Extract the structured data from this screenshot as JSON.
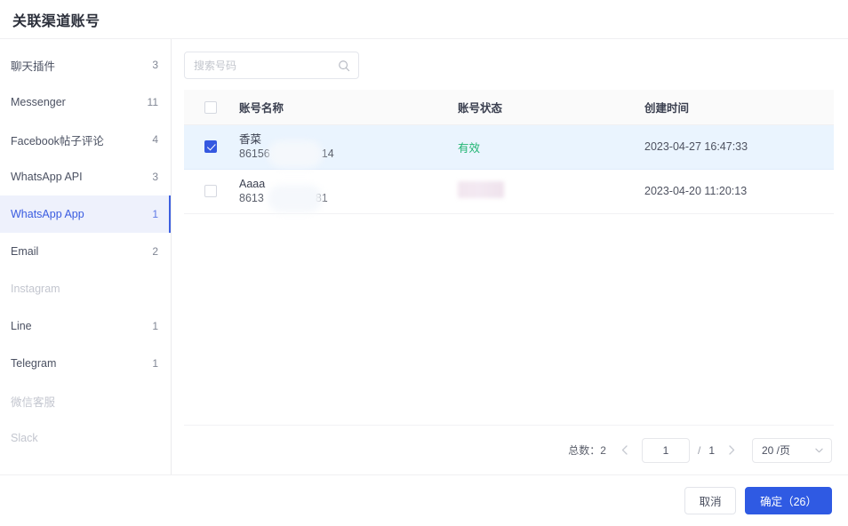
{
  "header": {
    "title": "关联渠道账号"
  },
  "sidebar": {
    "items": [
      {
        "label": "聊天插件",
        "count": "3",
        "state": "normal"
      },
      {
        "label": "Messenger",
        "count": "11",
        "state": "normal"
      },
      {
        "label": "Facebook帖子评论",
        "count": "4",
        "state": "normal"
      },
      {
        "label": "WhatsApp API",
        "count": "3",
        "state": "normal"
      },
      {
        "label": "WhatsApp App",
        "count": "1",
        "state": "active"
      },
      {
        "label": "Email",
        "count": "2",
        "state": "normal"
      },
      {
        "label": "Instagram",
        "count": "",
        "state": "disabled"
      },
      {
        "label": "Line",
        "count": "1",
        "state": "normal"
      },
      {
        "label": "Telegram",
        "count": "1",
        "state": "normal"
      },
      {
        "label": "微信客服",
        "count": "",
        "state": "disabled"
      },
      {
        "label": "Slack",
        "count": "",
        "state": "disabled"
      }
    ]
  },
  "search": {
    "placeholder": "搜索号码",
    "value": "",
    "icon": "search-icon"
  },
  "table": {
    "columns": [
      {
        "key": "checkbox",
        "label": ""
      },
      {
        "key": "name",
        "label": "账号名称"
      },
      {
        "key": "status",
        "label": "账号状态"
      },
      {
        "key": "time",
        "label": "创建时间"
      }
    ],
    "header_checkbox_checked": false,
    "rows": [
      {
        "selected": true,
        "name": "香菜",
        "phone_prefix": "86156",
        "phone_suffix": "14",
        "phone_masked": true,
        "status": "有效",
        "status_redacted": false,
        "time": "2023-04-27 16:47:33"
      },
      {
        "selected": false,
        "name": "Aaaa",
        "phone_prefix": "8613",
        "phone_suffix": "81",
        "phone_masked": true,
        "status": "",
        "status_redacted": true,
        "time": "2023-04-20 11:20:13"
      }
    ]
  },
  "pagination": {
    "total_label": "总数：2",
    "prev_icon": "chevron-left-icon",
    "next_icon": "chevron-right-icon",
    "current_page": "1",
    "separator": "/",
    "total_pages": "1",
    "page_size": "20 /页",
    "caret_icon": "chevron-down-icon"
  },
  "footer": {
    "cancel_label": "取消",
    "confirm_label": "确定（26）"
  },
  "colors": {
    "primary": "#2f5ae3",
    "active_bg": "#eef1fc",
    "active_text": "#3a5ce0",
    "row_selected_bg": "#eaf4fe",
    "status_ok": "#21b573",
    "header_bg": "#fafafa"
  }
}
